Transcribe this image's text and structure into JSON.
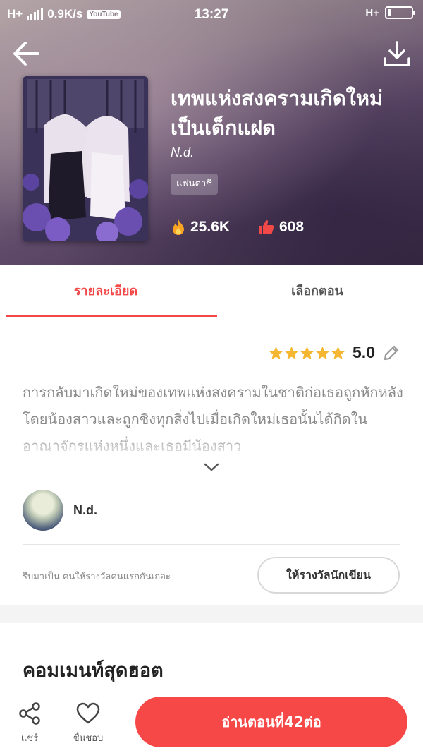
{
  "status_bar": {
    "network_left": "H+",
    "speed": "0.9K/s",
    "app_badge": "YouTube",
    "time": "13:27",
    "network_right": "H+"
  },
  "book": {
    "title": "เทพแห่งสงครามเกิดใหม่เป็นเด็กแฝด",
    "author": "N.d.",
    "genre_tag": "แฟนตาซี",
    "views": "25.6K",
    "likes": "608"
  },
  "tabs": [
    {
      "label": "รายละเอียด",
      "active": true
    },
    {
      "label": "เลือกตอน",
      "active": false
    }
  ],
  "rating": {
    "value": "5.0",
    "stars": 5
  },
  "description": "การกลับมาเกิดใหม่ของเทพแห่งสงครามในชาติก่อเธอถูกหักหลังโดยน้องสาวและถูกชิงทุกสิ่งไปเมื่อเกิดใหม่เธอนั้นได้กิดในอาณาจักรแห่งหนึ่งและเธอมีน้องสาว",
  "author_row": {
    "name": "N.d."
  },
  "reward": {
    "hint": "รีบมาเป็น คนให้รางวัลคนแรกกันเถอะ",
    "button_label": "ให้รางวัลนักเขียน"
  },
  "hot_comments": {
    "title": "คอมเมนท์สุดฮอต"
  },
  "bottom_bar": {
    "share_label": "แชร์",
    "like_label": "ชื่นชอบ",
    "read_button": "อ่านตอนที่42ต่อ"
  },
  "colors": {
    "accent": "#f24848",
    "star": "#f5b731",
    "read_button_bg": "#f74848"
  },
  "icons": [
    "back-arrow-icon",
    "download-icon",
    "fire-icon",
    "thumbs-up-icon",
    "star-icon",
    "edit-pencil-icon",
    "chevron-down-icon",
    "share-icon",
    "heart-icon"
  ]
}
